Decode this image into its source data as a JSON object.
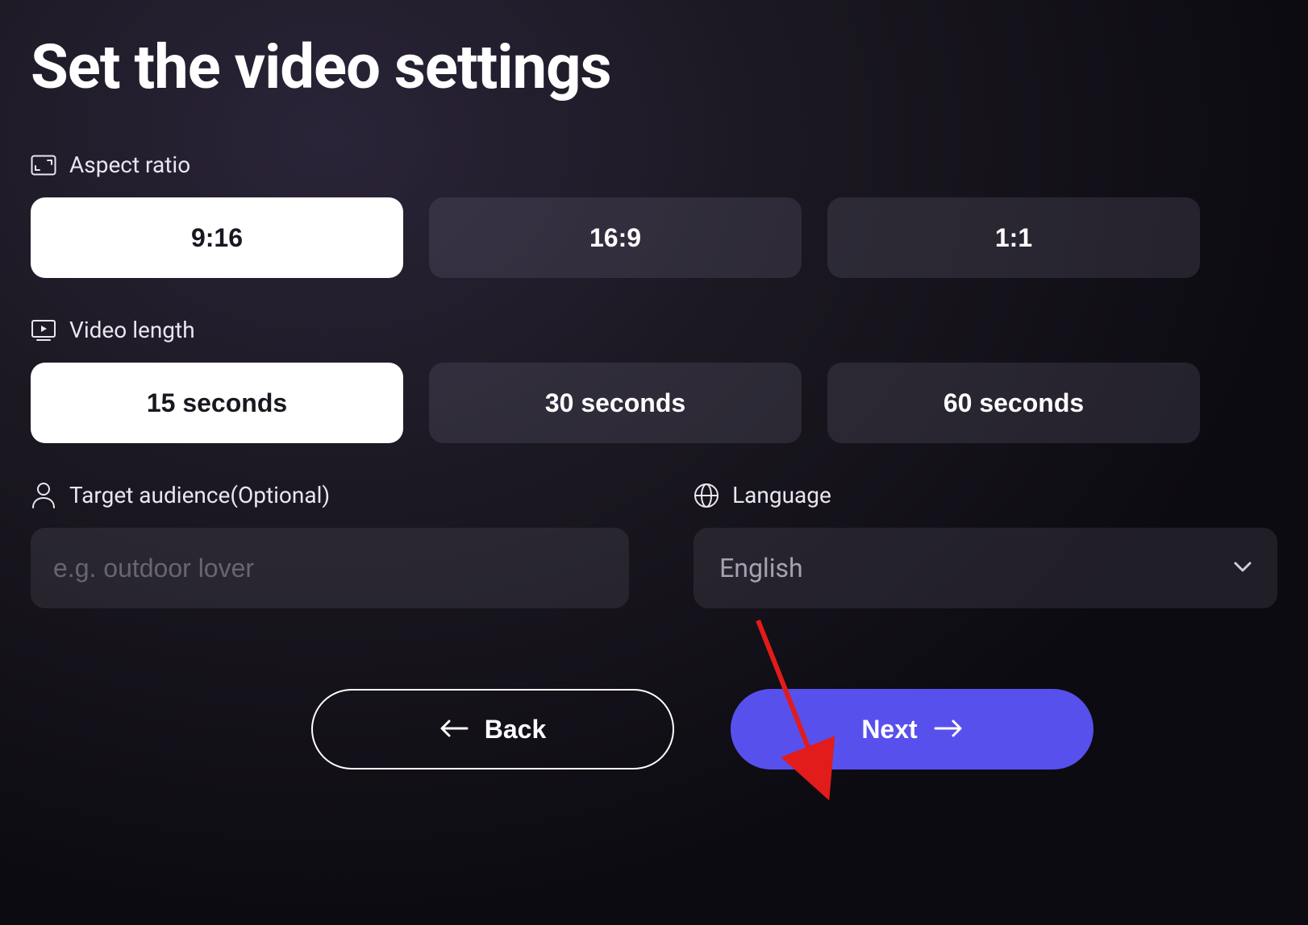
{
  "title": "Set the video settings",
  "sections": {
    "aspect_ratio": {
      "label": "Aspect ratio",
      "options": [
        "9:16",
        "16:9",
        "1:1"
      ],
      "selected": "9:16"
    },
    "video_length": {
      "label": "Video length",
      "options": [
        "15 seconds",
        "30 seconds",
        "60 seconds"
      ],
      "selected": "15 seconds"
    },
    "target_audience": {
      "label": "Target audience(Optional)",
      "placeholder": "e.g. outdoor lover",
      "value": ""
    },
    "language": {
      "label": "Language",
      "value": "English"
    }
  },
  "nav": {
    "back": "Back",
    "next": "Next"
  }
}
